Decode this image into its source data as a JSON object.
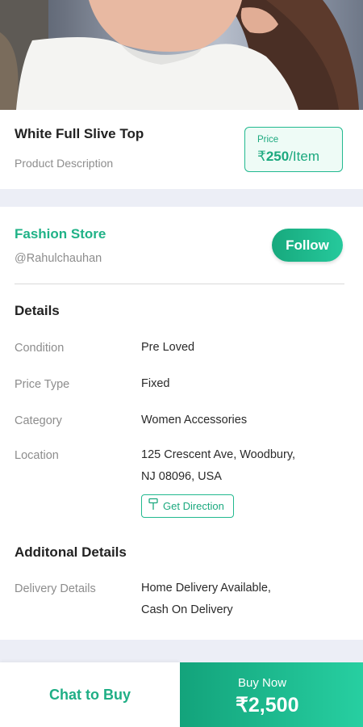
{
  "product": {
    "title": "White Full Slive Top",
    "description_label": "Product Description",
    "price_label": "Price",
    "currency": "₹",
    "price_amount": "250",
    "price_unit": "/Item"
  },
  "store": {
    "name": "Fashion Store",
    "handle": "@Rahulchauhan",
    "follow_label": "Follow"
  },
  "details": {
    "title": "Details",
    "rows": [
      {
        "label": "Condition",
        "value": "Pre Loved"
      },
      {
        "label": "Price Type",
        "value": "Fixed"
      },
      {
        "label": "Category",
        "value": "Women Accessories"
      },
      {
        "label": "Location",
        "value_line1": "125 Crescent Ave, Woodbury,",
        "value_line2": "NJ 08096, USA"
      }
    ],
    "direction_label": "Get Direction"
  },
  "additional": {
    "title": "Additonal Details",
    "rows": [
      {
        "label": "Delivery Details",
        "value_line1": "Home Delivery Available,",
        "value_line2": "Cash On Delivery"
      }
    ]
  },
  "bottom": {
    "chat_label": "Chat to Buy",
    "buy_label": "Buy Now",
    "currency": "₹",
    "buy_amount": "2,500"
  },
  "colors": {
    "accent": "#1fae85",
    "separator": "#eceef6"
  },
  "icons": {
    "direction": "signpost-icon"
  }
}
